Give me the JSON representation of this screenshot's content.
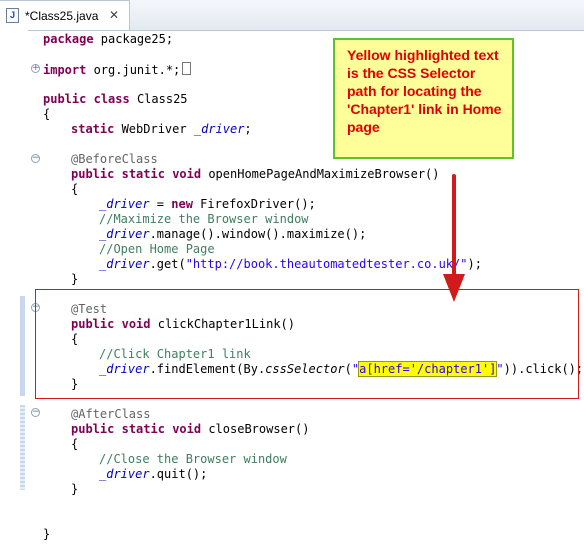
{
  "tab": {
    "title": "*Class25.java",
    "close": "✕",
    "file_icon": "J"
  },
  "callout": {
    "text": "Yellow highlighted text is the CSS Selector path for locating the 'Chapter1' link in Home page"
  },
  "code": {
    "l1": [
      "package",
      " package25;"
    ],
    "l2": [
      "import",
      " org.junit.*;"
    ],
    "l3": [
      "public",
      " ",
      "class",
      " Class25"
    ],
    "l4": "{",
    "l5": [
      "static",
      " WebDriver ",
      "_driver",
      ";"
    ],
    "l6": "@BeforeClass",
    "l7": [
      "public",
      " ",
      "static",
      " ",
      "void",
      " openHomePageAndMaximizeBrowser()"
    ],
    "l8": "{",
    "l9": [
      "_driver",
      " = ",
      "new",
      " FirefoxDriver();"
    ],
    "l10": "//Maximize the Browser window",
    "l11": [
      "_driver",
      ".manage().window().maximize();"
    ],
    "l12": "//Open Home Page",
    "l13": [
      "_driver",
      ".get(",
      "\"http://book.theautomatedtester.co.uk/\"",
      ");"
    ],
    "l14": "}",
    "l15": "@Test",
    "l16": [
      "public",
      " ",
      "void",
      " clickChapter1Link()"
    ],
    "l17": "{",
    "l18": "//Click Chapter1 link",
    "l19": [
      "_driver",
      ".findElement(By.",
      "cssSelector",
      "(",
      "\"",
      "a[href='/chapter1']",
      "\"",
      ")).click();"
    ],
    "l20": "}",
    "l21": "@AfterClass",
    "l22": [
      "public",
      " ",
      "static",
      " ",
      "void",
      " closeBrowser()"
    ],
    "l23": "{",
    "l24": "//Close the Browser window",
    "l25": [
      "_driver",
      ".quit();"
    ],
    "l26": "}",
    "l27": "}"
  },
  "colors": {
    "keyword": "#7f0055",
    "field": "#0000c0",
    "comment": "#3f7f5f",
    "string": "#2a00ff",
    "annotation": "#646464",
    "highlight": "#ffff00",
    "arrow": "#d21a1a",
    "callout_border": "#5bc42a"
  },
  "icons": [
    "java-file-icon",
    "close-icon",
    "fold-plus-icon",
    "fold-minus-icon",
    "down-arrow-icon"
  ]
}
